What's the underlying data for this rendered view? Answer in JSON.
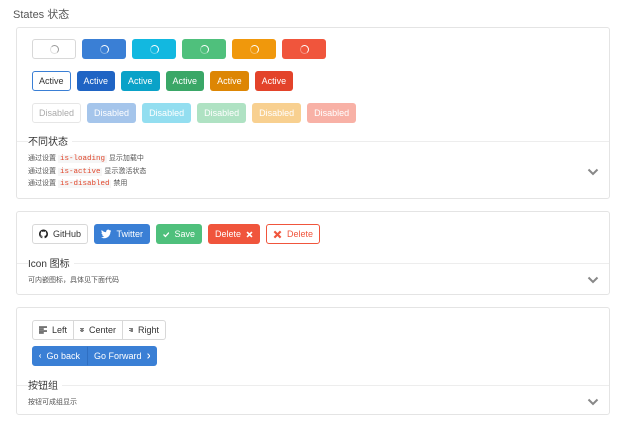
{
  "page": {
    "title": "States 状态"
  },
  "states": {
    "loading_buttons": [
      "default",
      "primary",
      "info",
      "success",
      "warning",
      "danger"
    ],
    "active_buttons": [
      {
        "variant": "default",
        "label": "Active"
      },
      {
        "variant": "primary",
        "label": "Active"
      },
      {
        "variant": "info",
        "label": "Active"
      },
      {
        "variant": "success",
        "label": "Active"
      },
      {
        "variant": "warning",
        "label": "Active"
      },
      {
        "variant": "danger",
        "label": "Active"
      }
    ],
    "disabled_buttons": [
      {
        "variant": "default",
        "label": "Disabled"
      },
      {
        "variant": "primary",
        "label": "Disabled"
      },
      {
        "variant": "info",
        "label": "Disabled"
      },
      {
        "variant": "success",
        "label": "Disabled"
      },
      {
        "variant": "warning",
        "label": "Disabled"
      },
      {
        "variant": "danger",
        "label": "Disabled"
      }
    ],
    "meta_title": "不同状态",
    "desc_lines": [
      {
        "prefix": "通过设置",
        "code": "is-loading",
        "suffix": "显示加载中"
      },
      {
        "prefix": "通过设置",
        "code": "is-active",
        "suffix": "显示激活状态"
      },
      {
        "prefix": "通过设置",
        "code": "is-disabled",
        "suffix": "禁用"
      }
    ]
  },
  "icons": {
    "github_label": "GitHub",
    "twitter_label": "Twitter",
    "save_label": "Save",
    "delete_label": "Delete",
    "delete_outline_label": "Delete",
    "meta_title": "Icon 图标",
    "desc": "可内嵌图标，具体见下面代码"
  },
  "groups": {
    "left_label": "Left",
    "center_label": "Center",
    "right_label": "Right",
    "back_label": "Go back",
    "forward_label": "Go Forward",
    "meta_title": "按钮组",
    "desc": "按钮可成组显示"
  },
  "colors": {
    "primary": "#3a7fd5",
    "info": "#12b8e0",
    "success": "#4fc07c",
    "warning": "#f0980c",
    "danger": "#f0553c",
    "code": "#e0472c"
  }
}
